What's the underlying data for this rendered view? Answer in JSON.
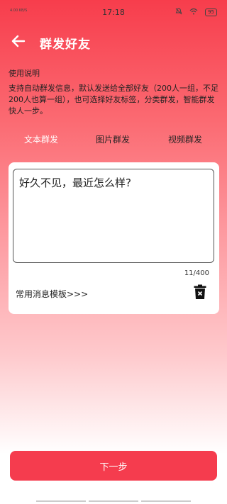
{
  "status_bar": {
    "carrier_info": "4.00 KB/S",
    "time": "17:18",
    "battery": "95"
  },
  "header": {
    "title": "群发好友"
  },
  "usage": {
    "title": "使用说明",
    "text": "支持自动群发信息，默认发送给全部好友（200人一组，不足200人也算一组），也可选择好友标签，分类群发，智能群发快人一步。"
  },
  "tabs": [
    {
      "label": "文本群发",
      "active": true
    },
    {
      "label": "图片群发",
      "active": false
    },
    {
      "label": "视频群发",
      "active": false
    }
  ],
  "editor": {
    "value": "好久不见，最近怎么样?",
    "counter": "11/400",
    "template_link": "常用消息模板>>>"
  },
  "footer": {
    "next_label": "下一步"
  },
  "colors": {
    "accent": "#f53c4e",
    "header_bg": "#f73d4c"
  },
  "icons": [
    "back-arrow-icon",
    "mute-icon",
    "wifi-icon",
    "battery-icon",
    "trash-icon"
  ]
}
